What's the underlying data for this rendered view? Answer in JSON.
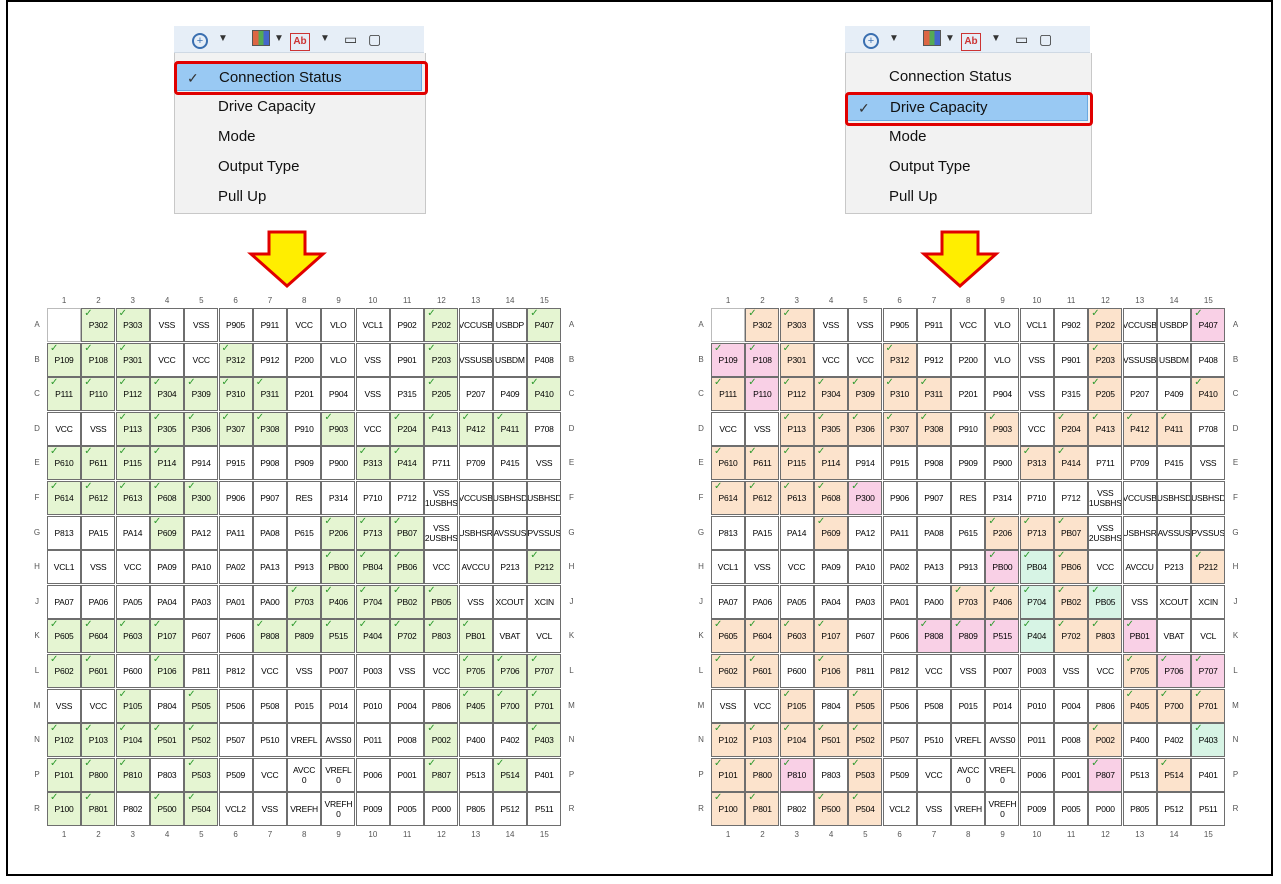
{
  "menu": {
    "items": [
      "Connection Status",
      "Drive Capacity",
      "Mode",
      "Output Type",
      "Pull Up"
    ],
    "left_selected": "Connection Status",
    "right_selected": "Drive Capacity"
  },
  "grid": {
    "columns": [
      "1",
      "2",
      "3",
      "4",
      "5",
      "6",
      "7",
      "8",
      "9",
      "10",
      "11",
      "12",
      "13",
      "14",
      "15"
    ],
    "rows": [
      "A",
      "B",
      "C",
      "D",
      "E",
      "F",
      "G",
      "H",
      "J",
      "K",
      "L",
      "M",
      "N",
      "P",
      "R"
    ],
    "pins": [
      [
        "",
        "P302",
        "P303",
        "VSS",
        "VSS",
        "P905",
        "P911",
        "VCC",
        "VLO",
        "VCL1",
        "P902",
        "P202",
        "VCCUSB",
        "USBDP",
        "P407"
      ],
      [
        "P109",
        "P108",
        "P301",
        "VCC",
        "VCC",
        "P312",
        "P912",
        "P200",
        "VLO",
        "VSS",
        "P901",
        "P203",
        "VSSUSB",
        "USBDM",
        "P408"
      ],
      [
        "P111",
        "P110",
        "P112",
        "P304",
        "P309",
        "P310",
        "P311",
        "P201",
        "P904",
        "VSS",
        "P315",
        "P205",
        "P207",
        "P409",
        "P410"
      ],
      [
        "VCC",
        "VSS",
        "P113",
        "P305",
        "P306",
        "P307",
        "P308",
        "P910",
        "P903",
        "VCC",
        "P204",
        "P413",
        "P412",
        "P411",
        "P708"
      ],
      [
        "P610",
        "P611",
        "P115",
        "P114",
        "P914",
        "P915",
        "P908",
        "P909",
        "P900",
        "P313",
        "P414",
        "P711",
        "P709",
        "P415",
        "VSS"
      ],
      [
        "P614",
        "P612",
        "P613",
        "P608",
        "P300",
        "P906",
        "P907",
        "RES",
        "P314",
        "P710",
        "P712",
        "VSS\n1USBHS",
        "VCCUSB",
        "USBHSD",
        "USBHSD"
      ],
      [
        "P813",
        "PA15",
        "PA14",
        "P609",
        "PA12",
        "PA11",
        "PA08",
        "P615",
        "P206",
        "P713",
        "PB07",
        "VSS\n2USBHS",
        "USBHSR",
        "AVSSUS",
        "PVSSUS"
      ],
      [
        "VCL1",
        "VSS",
        "VCC",
        "PA09",
        "PA10",
        "PA02",
        "PA13",
        "P913",
        "PB00",
        "PB04",
        "PB06",
        "VCC",
        "AVCCU",
        "P213",
        "P212"
      ],
      [
        "PA07",
        "PA06",
        "PA05",
        "PA04",
        "PA03",
        "PA01",
        "PA00",
        "P703",
        "P406",
        "P704",
        "PB02",
        "PB05",
        "VSS",
        "XCOUT",
        "XCIN"
      ],
      [
        "P605",
        "P604",
        "P603",
        "P107",
        "P607",
        "P606",
        "P808",
        "P809",
        "P515",
        "P404",
        "P702",
        "P803",
        "PB01",
        "VBAT",
        "VCL"
      ],
      [
        "P602",
        "P601",
        "P600",
        "P106",
        "P811",
        "P812",
        "VCC",
        "VSS",
        "P007",
        "P003",
        "VSS",
        "VCC",
        "P705",
        "P706",
        "P707"
      ],
      [
        "VSS",
        "VCC",
        "P105",
        "P804",
        "P505",
        "P506",
        "P508",
        "P015",
        "P014",
        "P010",
        "P004",
        "P806",
        "P405",
        "P700",
        "P701"
      ],
      [
        "P102",
        "P103",
        "P104",
        "P501",
        "P502",
        "P507",
        "P510",
        "VREFL",
        "AVSS0",
        "P011",
        "P008",
        "P002",
        "P400",
        "P402",
        "P403"
      ],
      [
        "P101",
        "P800",
        "P810",
        "P803",
        "P503",
        "P509",
        "VCC",
        "AVCC\n0",
        "VREFL\n0",
        "P006",
        "P001",
        "P807",
        "P513",
        "P514",
        "P401"
      ],
      [
        "P100",
        "P801",
        "P802",
        "P500",
        "P504",
        "VCL2",
        "VSS",
        "VREFH",
        "VREFH\n0",
        "P009",
        "P005",
        "P000",
        "P805",
        "P512",
        "P511"
      ]
    ]
  },
  "left_status": [
    "0GG0000000GG0GG0GG0G",
    "",
    ""
  ],
  "colors": {
    "connected": "#e5f5d2",
    "drive_low": "#fce3cc",
    "drive_high": "#f9d0e6",
    "drive_mid": "#d7f4e5",
    "selection": "#99c9f3",
    "highlight": "#e00000",
    "arrow_fill": "#ffee00",
    "arrow_stroke": "#e00000"
  },
  "icons": [
    "zoom-icon",
    "chevron-down-icon",
    "color-grid-icon",
    "text-label-icon",
    "minimize-icon",
    "maximize-icon",
    "checkmark-icon"
  ]
}
